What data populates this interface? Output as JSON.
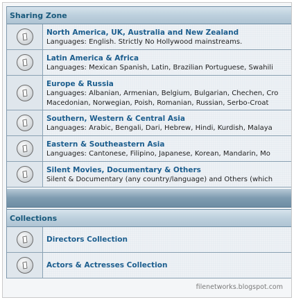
{
  "sections": [
    {
      "header": "Sharing Zone",
      "forums": [
        {
          "title": "North America, UK, Australia and New Zealand",
          "desc": [
            "Languages: English. Strictly No Hollywood mainstreams."
          ]
        },
        {
          "title": "Latin America & Africa",
          "desc": [
            "Languages: Mexican Spanish, Latin, Brazilian Portuguese, Swahili"
          ]
        },
        {
          "title": "Europe & Russia",
          "desc": [
            "Languages: Albanian, Armenian, Belgium, Bulgarian, Chechen, Cro",
            "Macedonian, Norwegian, Poish, Romanian, Russian, Serbo-Croat"
          ]
        },
        {
          "title": "Southern, Western & Central Asia",
          "desc": [
            "Languages: Arabic, Bengali, Dari, Hebrew, Hindi, Kurdish, Malaya"
          ]
        },
        {
          "title": "Eastern & Southeastern Asia",
          "desc": [
            "Languages: Cantonese, Filipino, Japanese, Korean, Mandarin, Mo"
          ]
        },
        {
          "title": "Silent Movies, Documentary & Others",
          "desc": [
            "Silent & Documentary (any country/language) and Others (which"
          ]
        }
      ]
    },
    {
      "header": "Collections",
      "forums": [
        {
          "title": "Directors Collection"
        },
        {
          "title": "Actors & Actresses Collection"
        }
      ]
    }
  ],
  "icon": "folder-read-icon",
  "watermark": "filenetworks.blogspot.com"
}
